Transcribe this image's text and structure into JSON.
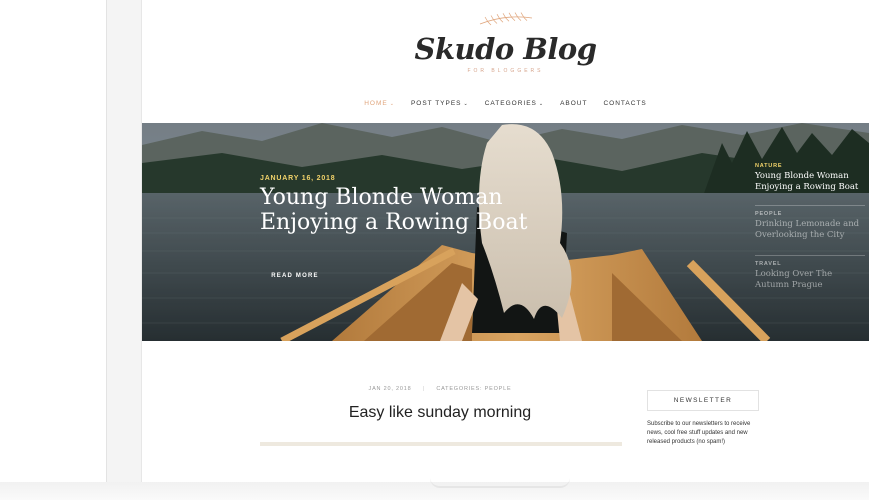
{
  "site": {
    "logo_text": "Skudo Blog",
    "logo_tagline": "FOR BLOGGERS",
    "accent_color": "#e0a57c"
  },
  "nav": {
    "items": [
      {
        "label": "HOME",
        "has_dropdown": true,
        "active": true
      },
      {
        "label": "POST TYPES",
        "has_dropdown": true,
        "active": false
      },
      {
        "label": "CATEGORIES",
        "has_dropdown": true,
        "active": false
      },
      {
        "label": "ABOUT",
        "has_dropdown": false,
        "active": false
      },
      {
        "label": "CONTACTS",
        "has_dropdown": false,
        "active": false
      }
    ],
    "caret_glyph": "⌄"
  },
  "hero": {
    "date": "JANUARY 16, 2018",
    "title": "Young Blonde Woman Enjoying a Rowing Boat",
    "button_label": "READ MORE",
    "side_posts": [
      {
        "category": "NATURE",
        "title": "Young Blonde Woman Enjoying a Rowing Boat",
        "active": true
      },
      {
        "category": "PEOPLE",
        "title": "Drinking Lemonade and Overlooking the City",
        "active": false
      },
      {
        "category": "TRAVEL",
        "title": "Looking Over The Autumn Prague",
        "active": false
      }
    ]
  },
  "post": {
    "date": "JAN 20, 2018",
    "separator": "|",
    "categories": "CATEGORIES: PEOPLE",
    "title": "Easy like sunday morning"
  },
  "sidebar": {
    "newsletter_heading": "NEWSLETTER",
    "newsletter_text": "Subscribe to our newsletters to receive news, cool free stuff updates and new released products (no spam!)"
  }
}
